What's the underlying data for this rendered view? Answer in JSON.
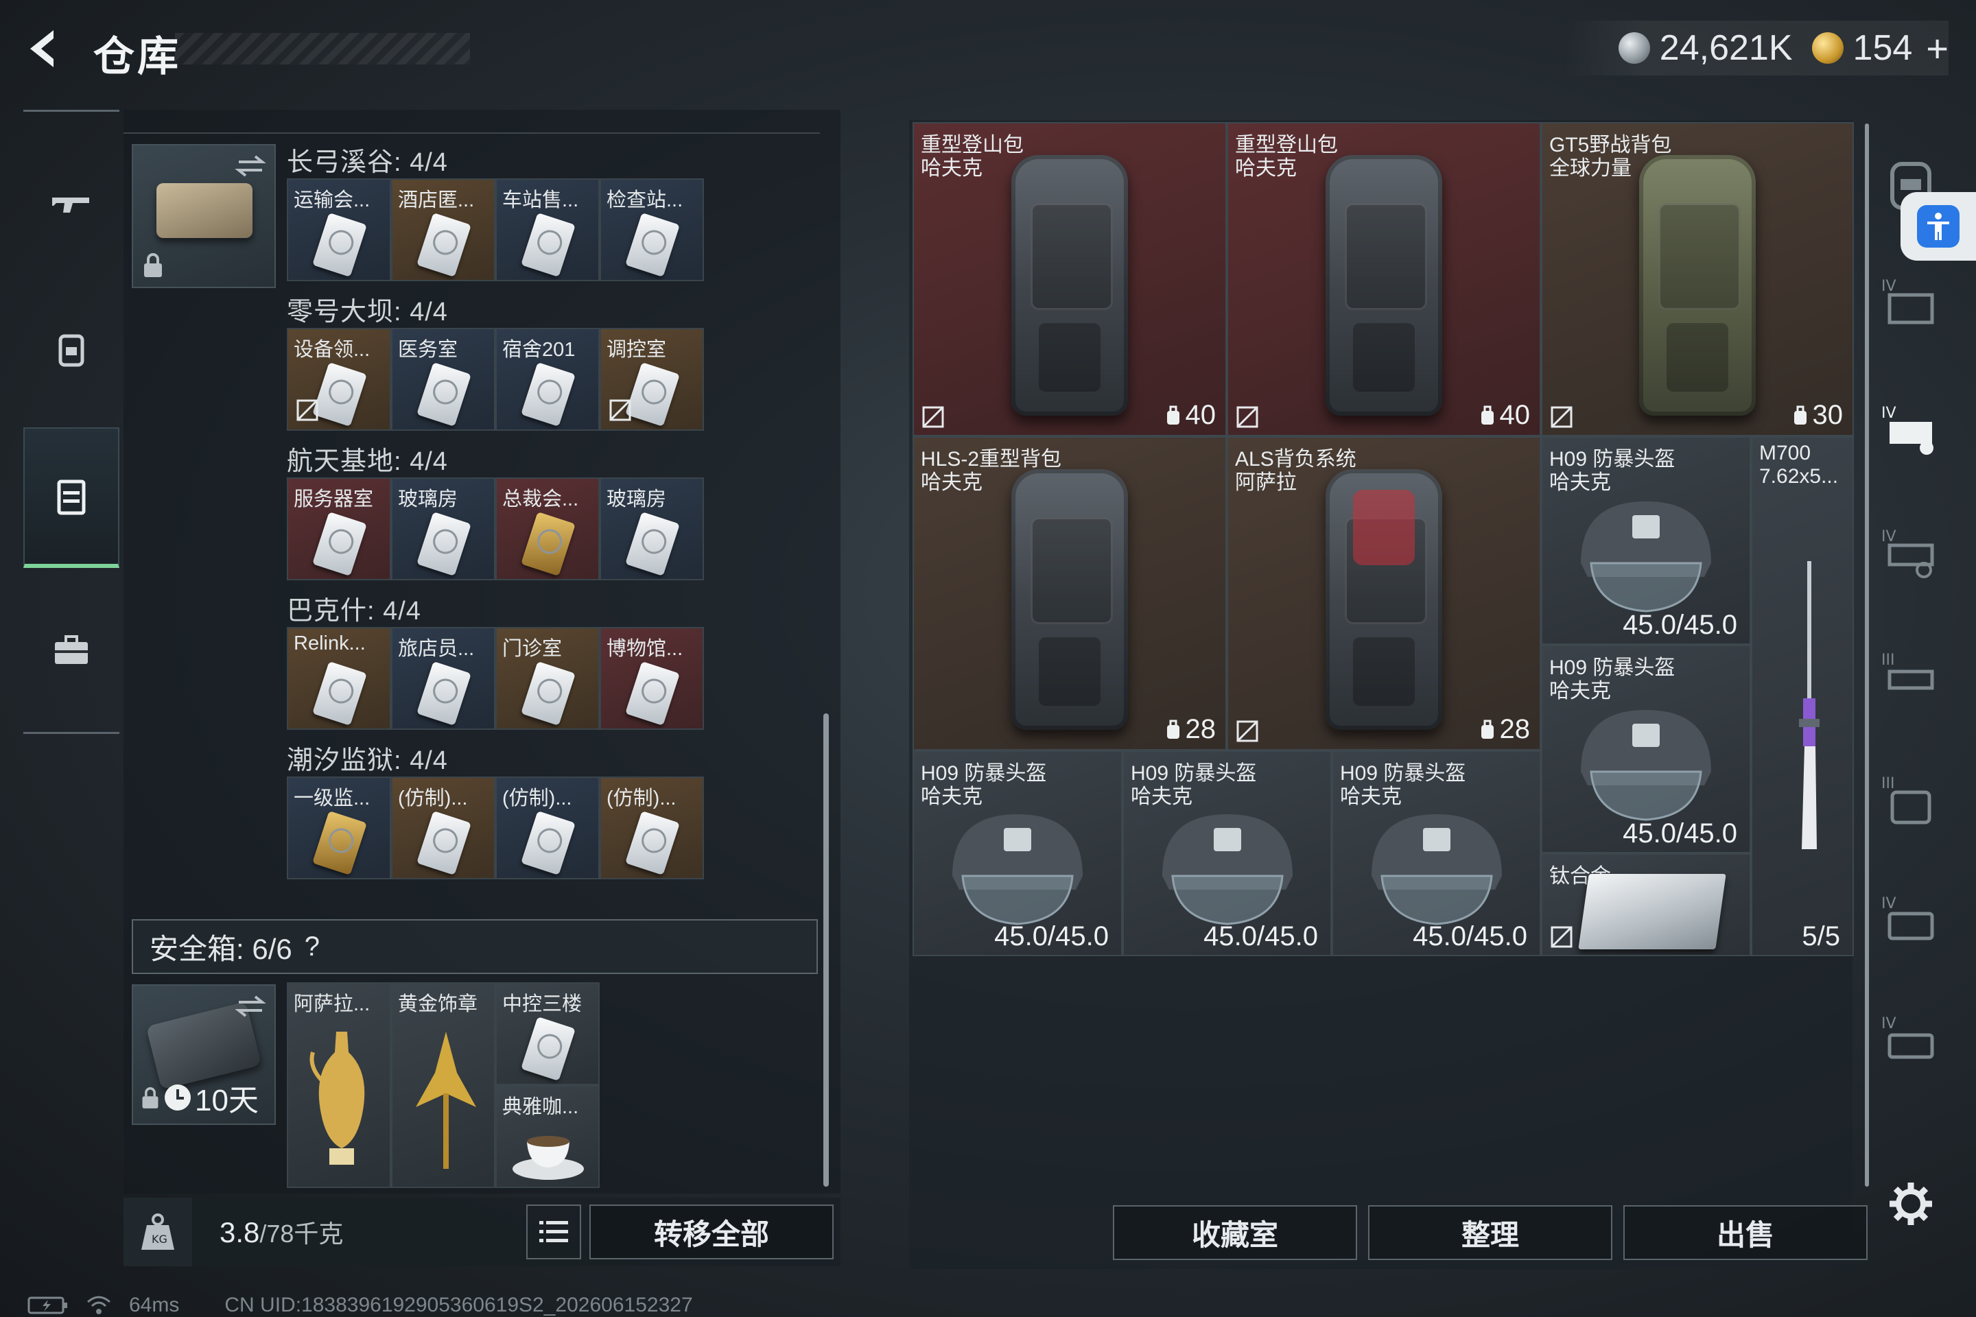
{
  "header": {
    "title": "仓库",
    "currency_main": "24,621K",
    "currency_secondary": "154",
    "currency_plus": "+"
  },
  "left_rail": {
    "items": [
      {
        "name": "weapons",
        "icon": "gun-icon"
      },
      {
        "name": "gear",
        "icon": "backpack-icon"
      },
      {
        "name": "storage",
        "icon": "storage-icon",
        "active": true
      },
      {
        "name": "supplies",
        "icon": "briefcase-icon"
      }
    ]
  },
  "key_case": {
    "groups": [
      {
        "title": "长弓溪谷: 4/4",
        "slots": [
          {
            "label": "运输会...",
            "color": "blue"
          },
          {
            "label": "酒店匿...",
            "color": "gold"
          },
          {
            "label": "车站售...",
            "color": "blue"
          },
          {
            "label": "检查站...",
            "color": "blue"
          }
        ]
      },
      {
        "title": "零号大坝: 4/4",
        "slots": [
          {
            "label": "设备领...",
            "color": "gold"
          },
          {
            "label": "医务室",
            "color": "blue"
          },
          {
            "label": "宿舍201",
            "color": "blue"
          },
          {
            "label": "调控室",
            "color": "gold"
          }
        ]
      },
      {
        "title": "航天基地: 4/4",
        "slots": [
          {
            "label": "服务器室",
            "color": "red"
          },
          {
            "label": "玻璃房",
            "color": "blue"
          },
          {
            "label": "总裁会...",
            "color": "red"
          },
          {
            "label": "玻璃房",
            "color": "blue"
          }
        ]
      },
      {
        "title": "巴克什: 4/4",
        "slots": [
          {
            "label": "Relink...",
            "color": "gold"
          },
          {
            "label": "旅店员...",
            "color": "blue"
          },
          {
            "label": "门诊室",
            "color": "gold"
          },
          {
            "label": "博物馆...",
            "color": "red"
          }
        ]
      },
      {
        "title": "潮汐监狱: 4/4",
        "slots": [
          {
            "label": "一级监...",
            "color": "blue"
          },
          {
            "label": "(仿制)...",
            "color": "gold"
          },
          {
            "label": "(仿制)...",
            "color": "blue"
          },
          {
            "label": "(仿制)...",
            "color": "gold"
          }
        ]
      }
    ]
  },
  "safe_box": {
    "title": "安全箱: 6/6",
    "help": "?",
    "timer": "10天",
    "items": [
      {
        "label": "阿萨拉...",
        "icon": "golden-ewer-icon"
      },
      {
        "label": "黄金饰章",
        "icon": "gold-emblem-icon"
      },
      {
        "label": "中控三楼",
        "icon": "keycard-icon"
      },
      {
        "label": "典雅咖...",
        "icon": "coffee-cup-icon"
      }
    ]
  },
  "bottom_left": {
    "weight_value": "3.8",
    "weight_rest": "/78千克",
    "transfer_all": "转移全部"
  },
  "stash": {
    "backpacks": [
      {
        "name": "重型登山包",
        "maker": "哈夫克",
        "capacity": "40",
        "color": "red"
      },
      {
        "name": "重型登山包",
        "maker": "哈夫克",
        "capacity": "40",
        "color": "red"
      },
      {
        "name": "GT5野战背包",
        "maker": "全球力量",
        "capacity": "30",
        "color": "brown"
      },
      {
        "name": "HLS-2重型背包",
        "maker": "哈夫克",
        "capacity": "28",
        "color": "brown"
      },
      {
        "name": "ALS背负系统",
        "maker": "阿萨拉",
        "capacity": "28",
        "color": "brown"
      }
    ],
    "helmets": [
      {
        "name": "H09 防暴头盔",
        "maker": "哈夫克",
        "durability": "45.0/45.0"
      },
      {
        "name": "H09 防暴头盔",
        "maker": "哈夫克",
        "durability": "45.0/45.0"
      },
      {
        "name": "H09 防暴头盔",
        "maker": "哈夫克",
        "durability": "45.0/45.0"
      },
      {
        "name": "H09 防暴头盔",
        "maker": "哈夫克",
        "durability": "45.0/45.0"
      },
      {
        "name": "H09 防暴头盔",
        "maker": "哈夫克",
        "durability": "45.0/45.0"
      }
    ],
    "rifle": {
      "name": "M700",
      "ammo": "7.62x5...",
      "count": "5/5"
    },
    "ingot": {
      "name": "钛合金"
    }
  },
  "right_buttons": {
    "collection": "收藏室",
    "organize": "整理",
    "sell": "出售"
  },
  "status_bar": {
    "ping": "64ms",
    "uid": "CN UID:1838396192905360619S2_202606152327"
  },
  "colors": {
    "accent_green": "#7ed39a",
    "accessibility_blue": "#2a79e6"
  }
}
